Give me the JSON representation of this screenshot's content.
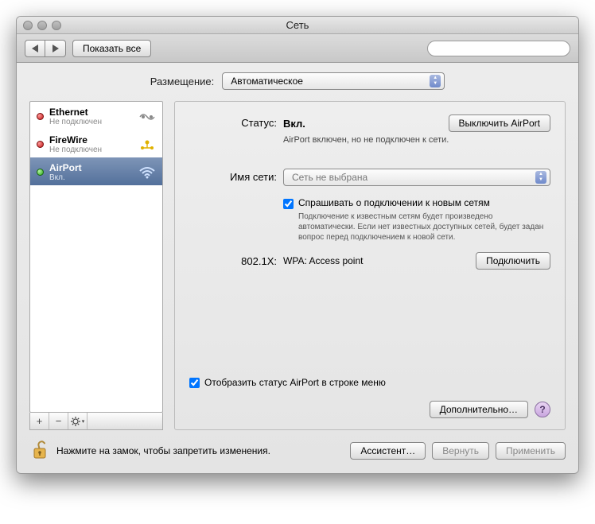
{
  "window": {
    "title": "Сеть"
  },
  "toolbar": {
    "show_all": "Показать все",
    "search_placeholder": ""
  },
  "location": {
    "label": "Размещение:",
    "value": "Автоматическое"
  },
  "sidebar": {
    "items": [
      {
        "title": "Ethernet",
        "sub": "Не подключен",
        "status": "red",
        "icon": "ethernet"
      },
      {
        "title": "FireWire",
        "sub": "Не подключен",
        "status": "red",
        "icon": "firewire"
      },
      {
        "title": "AirPort",
        "sub": "Вкл.",
        "status": "green",
        "icon": "airport",
        "selected": true
      }
    ]
  },
  "detail": {
    "status_label": "Статус:",
    "status_value": "Вкл.",
    "toggle_btn": "Выключить AirPort",
    "status_hint": "AirPort включен, но не подключен к сети.",
    "network_label": "Имя сети:",
    "network_value": "Сеть не выбрана",
    "ask_join_label": "Спрашивать о подключении к новым сетям",
    "ask_join_hint": "Подключение к известным сетям будет произведено автоматически. Если нет известных доступных сетей, будет задан вопрос перед подключением к новой сети.",
    "dot1x_label": "802.1X:",
    "dot1x_value": "WPA: Access point",
    "dot1x_btn": "Подключить",
    "show_menu_label": "Отобразить статус AirPort в строке меню",
    "advanced_btn": "Дополнительно…"
  },
  "footer": {
    "lock_text": "Нажмите на замок, чтобы запретить изменения.",
    "assist": "Ассистент…",
    "revert": "Вернуть",
    "apply": "Применить"
  }
}
